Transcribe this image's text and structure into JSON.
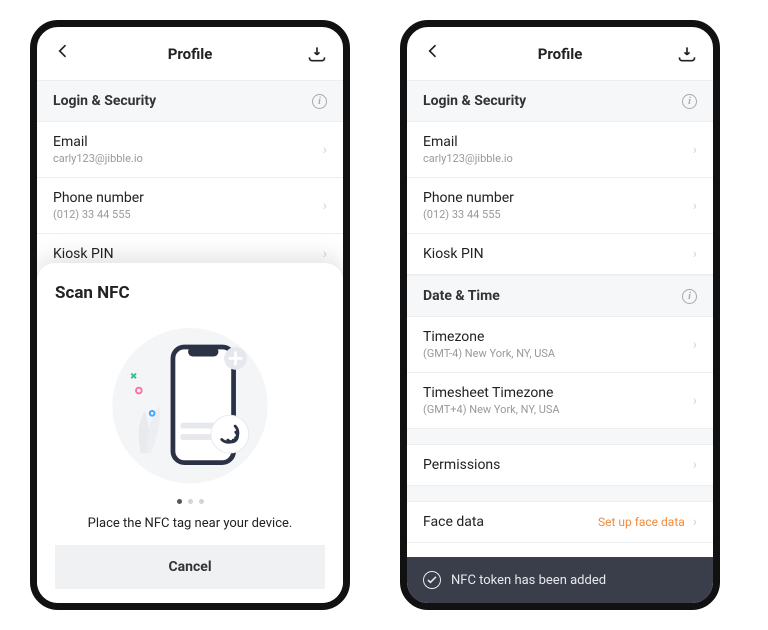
{
  "header": {
    "title": "Profile"
  },
  "sections": {
    "login": {
      "title": "Login & Security",
      "rows": {
        "email": {
          "label": "Email",
          "value": "carly123@jibble.io"
        },
        "phone": {
          "label": "Phone number",
          "value": "(012) 33 44 555"
        },
        "kiosk": {
          "label": "Kiosk PIN"
        }
      }
    },
    "datetime": {
      "title": "Date & Time",
      "rows": {
        "tz": {
          "label": "Timezone",
          "value": "(GMT-4) New York, NY, USA"
        },
        "tstz": {
          "label": "Timesheet Timezone",
          "value": "(GMT+4) New York, NY, USA"
        }
      }
    },
    "permissions": {
      "label": "Permissions"
    },
    "facedata": {
      "label": "Face data",
      "action": "Set up face data"
    }
  },
  "sheet": {
    "title": "Scan NFC",
    "message": "Place the NFC tag near your device.",
    "cancel": "Cancel"
  },
  "toast": {
    "message": "NFC token has been added"
  }
}
